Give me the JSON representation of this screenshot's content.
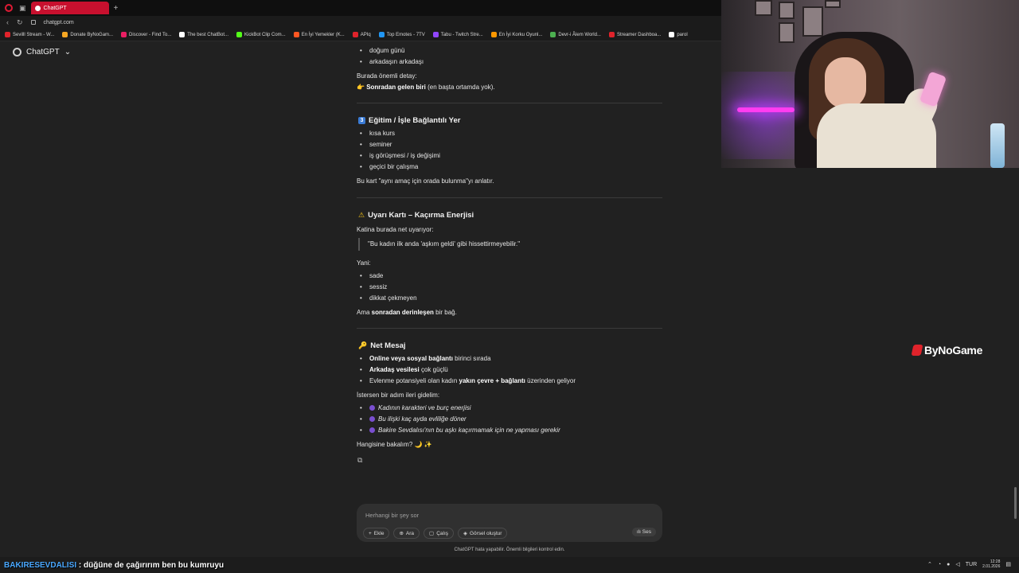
{
  "browser": {
    "tab_title": "ChatGPT",
    "new_tab": "+",
    "url": "chatgpt.com",
    "bookmarks": [
      {
        "label": "Sevilll Stream - W...",
        "color": "#e0232b"
      },
      {
        "label": "Donate ByNoGam...",
        "color": "#f5a623"
      },
      {
        "label": "Discover - Find To...",
        "color": "#e91e63"
      },
      {
        "label": "The best ChatBot...",
        "color": "#ffffff"
      },
      {
        "label": "KickBot Clip Com...",
        "color": "#53fc18"
      },
      {
        "label": "En İyi Yemekler (K...",
        "color": "#ff5722"
      },
      {
        "label": "APIq",
        "color": "#e0232b"
      },
      {
        "label": "Top Emotes - 7TV",
        "color": "#2196f3"
      },
      {
        "label": "Tabu - Twitch Stre...",
        "color": "#9146ff"
      },
      {
        "label": "En İyi Korku Oyunl...",
        "color": "#ff9800"
      },
      {
        "label": "Devr-i Âlem World...",
        "color": "#4caf50"
      },
      {
        "label": "Streamer Dashboa...",
        "color": "#e0232b"
      },
      {
        "label": "parol",
        "color": "#ffffff"
      }
    ]
  },
  "app": {
    "name": "ChatGPT",
    "dropdown": "⌄"
  },
  "message": {
    "top_bullets": [
      "doğum günü",
      "arkadaşın arkadaşı"
    ],
    "detail_label": "Burada önemli detay:",
    "detail_bold": "Sonradan gelen biri",
    "detail_rest": " (en başta ortamda yok).",
    "s3": {
      "num": "3",
      "title": "Eğitim / İşle Bağlantılı Yer",
      "bullets": [
        "kısa kurs",
        "seminer",
        "iş görüşmesi / iş değişimi",
        "geçici bir çalışma"
      ],
      "summary": "Bu kart \"aynı amaç için orada bulunma\"yı anlatır."
    },
    "warn": {
      "title": "Uyarı Kartı – Kaçırma Enerjisi",
      "intro": "Katina burada net uyarıyor:",
      "quote": "\"Bu kadın ilk anda 'aşkım geldi' gibi hissettirmeyebilir.\"",
      "yani": "Yani:",
      "bullets": [
        "sade",
        "sessiz",
        "dikkat çekmeyen"
      ],
      "end_pre": "Ama ",
      "end_bold": "sonradan derinleşen",
      "end_post": " bir bağ."
    },
    "net": {
      "title": "Net Mesaj",
      "b1_bold": "Online veya sosyal bağlantı",
      "b1_rest": " birinci sırada",
      "b2_bold": "Arkadaş vesilesi",
      "b2_rest": " çok güçlü",
      "b3_pre": "Evlenme potansiyeli olan kadın ",
      "b3_bold": "yakın çevre + bağlantı",
      "b3_post": " üzerinden geliyor",
      "next": "İstersen bir adım ileri gidelim:",
      "options": [
        "Kadının karakteri ve burç enerjisi",
        "Bu ilişki kaç ayda evliliğe döner",
        "Bakire Sevdalısı'nın bu aşkı kaçırmamak için ne yapması gerekir"
      ],
      "question": "Hangisine bakalım? 🌙 ✨"
    },
    "copy_icon": "⧉"
  },
  "composer": {
    "placeholder": "Herhangi bir şey sor",
    "tools": [
      {
        "icon": "+",
        "label": "Ekle"
      },
      {
        "icon": "⊕",
        "label": "Ara"
      },
      {
        "icon": "▢",
        "label": "Çalış"
      },
      {
        "icon": "◈",
        "label": "Görsel oluştur"
      }
    ],
    "voice": "Ses",
    "disclaimer": "ChatGPT hata yapabilir. Önemli bilgileri kontrol edin."
  },
  "overlay": {
    "logo": "ByNoGame",
    "chat_user": "BAKIRESEVDALISI",
    "chat_message": " : düğüne de çağırırım ben bu kumruyu"
  },
  "tray": {
    "time": "12:28",
    "date": "2.01.2026",
    "lang": "TUR"
  }
}
